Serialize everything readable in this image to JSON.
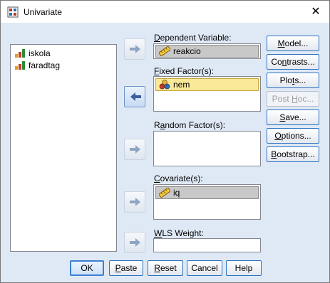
{
  "window": {
    "title": "Univariate",
    "close_glyph": "✕"
  },
  "variables": [
    {
      "name": "iskola",
      "icon": "ordinal-bar-icon"
    },
    {
      "name": "faradtag",
      "icon": "ordinal-bar-icon"
    }
  ],
  "targets": {
    "dependent": {
      "label_pre": "",
      "label_key": "D",
      "label_post": "ependent Variable:",
      "value": "reakcio",
      "icon": "ruler-scale-icon"
    },
    "fixed": {
      "label_pre": "",
      "label_key": "F",
      "label_post": "ixed Factor(s):",
      "value": "nem",
      "icon": "nominal-circles-icon"
    },
    "random": {
      "label_pre": "R",
      "label_key": "a",
      "label_post": "ndom Factor(s):"
    },
    "covariate": {
      "label_pre": "",
      "label_key": "C",
      "label_post": "ovariate(s):",
      "value": "iq",
      "icon": "ruler-scale-icon"
    },
    "wls": {
      "label_pre": "",
      "label_key": "W",
      "label_post": "LS Weight:"
    }
  },
  "side_buttons": [
    {
      "pre": "",
      "key": "M",
      "post": "odel...",
      "disabled": false
    },
    {
      "pre": "Co",
      "key": "n",
      "post": "trasts...",
      "disabled": false
    },
    {
      "pre": "Plo",
      "key": "t",
      "post": "s...",
      "disabled": false
    },
    {
      "pre": "Post ",
      "key": "H",
      "post": "oc...",
      "disabled": true
    },
    {
      "pre": "",
      "key": "S",
      "post": "ave...",
      "disabled": false
    },
    {
      "pre": "",
      "key": "O",
      "post": "ptions...",
      "disabled": false
    },
    {
      "pre": "",
      "key": "B",
      "post": "ootstrap...",
      "disabled": false
    }
  ],
  "bottom_buttons": [
    {
      "pre": "OK",
      "key": "",
      "post": "",
      "default": true
    },
    {
      "pre": "",
      "key": "P",
      "post": "aste",
      "default": false
    },
    {
      "pre": "",
      "key": "R",
      "post": "eset",
      "default": false
    },
    {
      "pre": "Cancel",
      "key": "",
      "post": "",
      "default": false
    },
    {
      "pre": "Help",
      "key": "",
      "post": "",
      "default": false
    }
  ],
  "colors": {
    "dialog_bg": "#dfe9f5",
    "button_border": "#2c72c4",
    "selected_item": "#fbe99a",
    "chip_gray": "#c8c8c8"
  }
}
